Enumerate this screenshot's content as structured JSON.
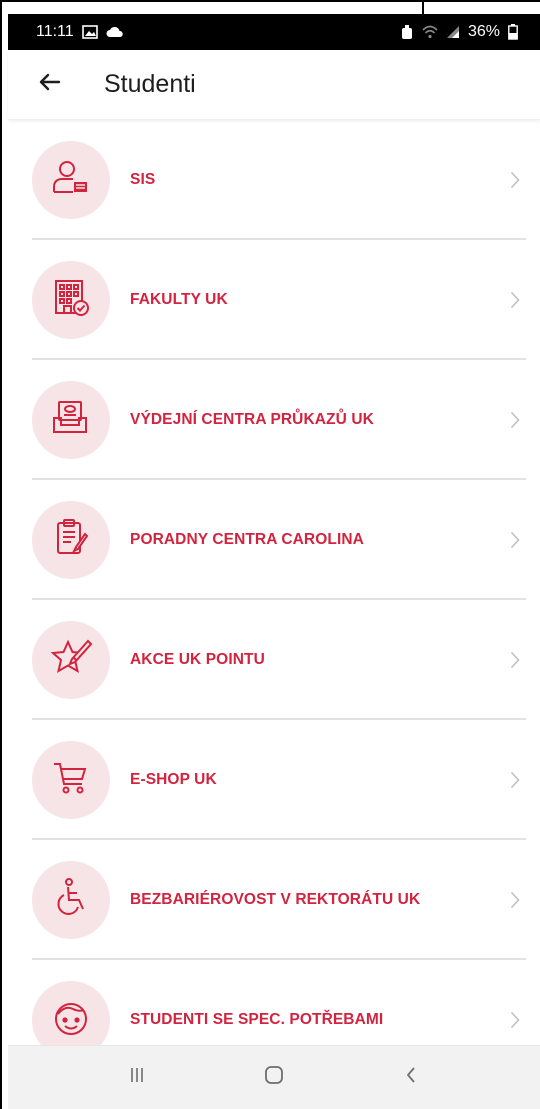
{
  "status_bar": {
    "time": "11:11",
    "battery": "36%",
    "icons": [
      "gallery-icon",
      "cloud-icon",
      "alarm-icon",
      "wifi-icon",
      "signal-icon",
      "battery-icon"
    ]
  },
  "app_bar": {
    "title": "Studenti",
    "back_icon": "arrow-left-icon"
  },
  "menu": {
    "items": [
      {
        "label": "SIS",
        "icon": "user-card-icon"
      },
      {
        "label": "FAKULTY UK",
        "icon": "building-check-icon"
      },
      {
        "label": "VÝDEJNÍ CENTRA PRŮKAZŮ UK",
        "icon": "card-tray-icon"
      },
      {
        "label": "PORADNY CENTRA CAROLINA",
        "icon": "clipboard-pencil-icon"
      },
      {
        "label": "AKCE UK POINTU",
        "icon": "star-pencil-icon"
      },
      {
        "label": "E-SHOP UK",
        "icon": "shopping-cart-icon"
      },
      {
        "label": "BEZBARIÉROVOST V REKTORÁTU UK",
        "icon": "wheelchair-icon"
      },
      {
        "label": "STUDENTI SE SPEC. POTŘEBAMI",
        "icon": "face-icon"
      }
    ]
  },
  "nav_bar": {
    "icons": [
      "recent-apps-icon",
      "home-icon",
      "back-icon"
    ]
  },
  "colors": {
    "accent": "#d2233f",
    "icon_background": "#f6e4e7",
    "status_bar": "#000000",
    "nav_bar": "#f2f2f2"
  }
}
